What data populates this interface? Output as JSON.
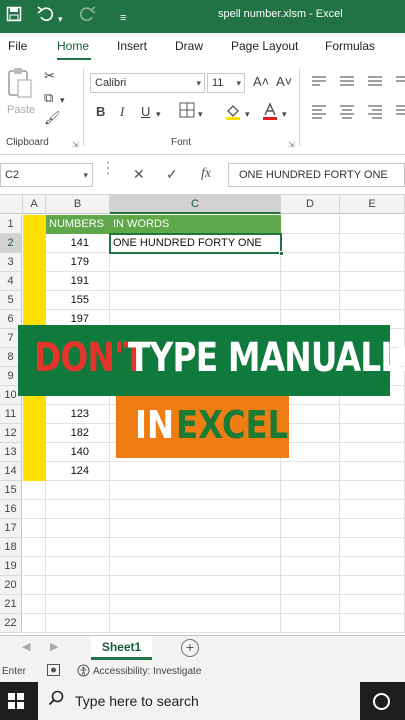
{
  "titlebar": {
    "title": "spell number.xlsm  -  Excel",
    "save_icon": "save-icon",
    "undo_icon": "undo-icon",
    "redo_icon": "redo-icon",
    "customize_icon": "customize-quick-access-icon"
  },
  "ribbon_tabs": [
    "File",
    "Home",
    "Insert",
    "Draw",
    "Page Layout",
    "Formulas"
  ],
  "ribbon": {
    "paste_label": "Paste",
    "clipboard_label": "Clipboard",
    "font_label": "Font",
    "font_name": "Calibri",
    "font_size": "11",
    "grow_font": "A˄",
    "shrink_font": "A˅",
    "bold": "B",
    "italic": "I",
    "underline": "U"
  },
  "formula_bar": {
    "name_box": "C2",
    "cancel": "✕",
    "enter": "✓",
    "fx": "fx",
    "content": "ONE HUNDRED FORTY ONE"
  },
  "grid": {
    "columns": [
      "A",
      "B",
      "C",
      "D",
      "E"
    ],
    "rows": [
      "1",
      "2",
      "3",
      "4",
      "5",
      "6",
      "7",
      "8",
      "9",
      "10",
      "11",
      "12",
      "13",
      "14",
      "15",
      "16",
      "17",
      "18",
      "19",
      "20",
      "21",
      "22"
    ],
    "header_b": "NUMBERS",
    "header_c": "IN WORDS",
    "numbers": [
      "141",
      "179",
      "191",
      "155",
      "197",
      "",
      "",
      "",
      "",
      "123",
      "182",
      "140",
      "124"
    ],
    "c2_value": "ONE HUNDRED FORTY ONE"
  },
  "overlay": {
    "line1_red": "DON'T",
    "line1_white": "TYPE MANUALLY",
    "line2_white": "IN",
    "line2_green": "EXCEL"
  },
  "sheets": {
    "active": "Sheet1",
    "add": "+"
  },
  "status": {
    "mode": "Enter",
    "accessibility": "Accessibility: Investigate"
  },
  "taskbar": {
    "search_placeholder": "Type here to search"
  },
  "colors": {
    "excel_green": "#217346",
    "banner_green": "#0f7a3c",
    "banner_orange": "#f07d14",
    "highlight_yellow": "#ffe000",
    "header_green": "#5ea84a"
  }
}
